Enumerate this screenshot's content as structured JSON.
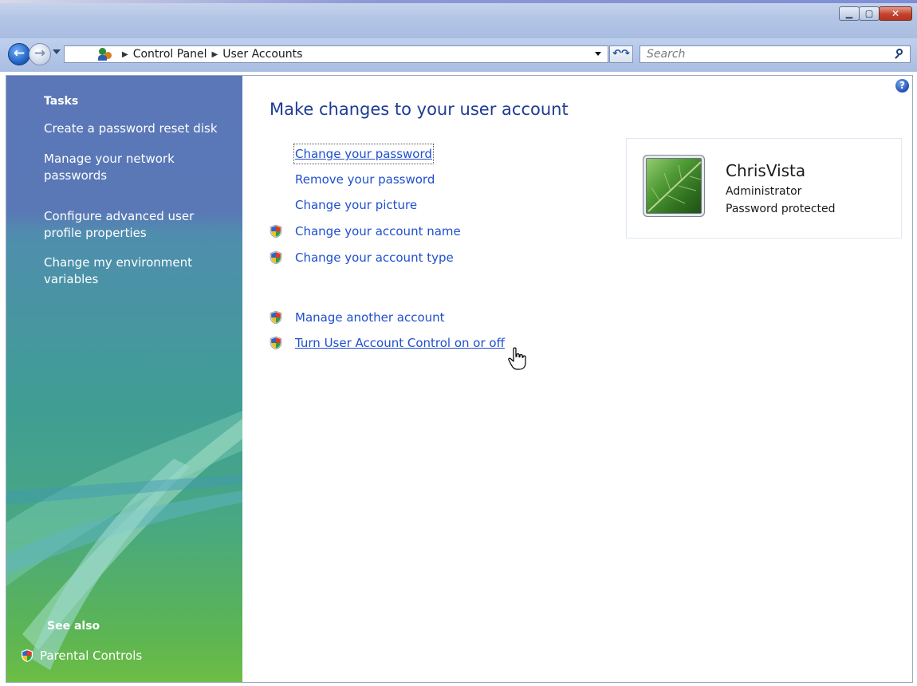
{
  "window": {
    "minimize_glyph": "▁",
    "maximize_glyph": "▢",
    "close_glyph": "✕"
  },
  "address_bar": {
    "breadcrumb": [
      "Control Panel",
      "User Accounts"
    ],
    "search_placeholder": "Search"
  },
  "sidebar": {
    "tasks_heading": "Tasks",
    "tasks": [
      "Create a password reset disk",
      "Manage your network passwords",
      "Configure advanced user profile properties",
      "Change my environment variables"
    ],
    "see_also_heading": "See also",
    "see_also": [
      "Parental Controls"
    ]
  },
  "main": {
    "title": "Make changes to your user account",
    "tasks": [
      {
        "label": "Change your password",
        "shield": false
      },
      {
        "label": "Remove your password",
        "shield": false
      },
      {
        "label": "Change your picture",
        "shield": false
      },
      {
        "label": "Change your account name",
        "shield": true
      },
      {
        "label": "Change your account type",
        "shield": true
      },
      {
        "label": "Manage another account",
        "shield": true
      },
      {
        "label": "Turn User Account Control on or off",
        "shield": true
      }
    ]
  },
  "account": {
    "name": "ChrisVista",
    "type": "Administrator",
    "status": "Password protected"
  },
  "colors": {
    "link": "#1f4fcf",
    "title": "#1e3c93",
    "sidebar_top": "#5b77b8",
    "sidebar_bottom": "#6dbd45"
  }
}
